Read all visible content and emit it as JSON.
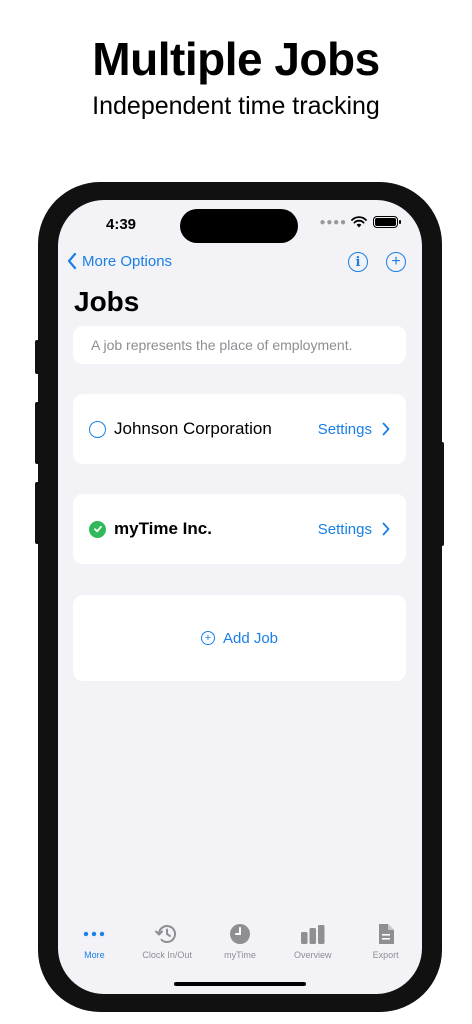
{
  "promo": {
    "headline": "Multiple Jobs",
    "subheadline": "Independent time tracking"
  },
  "status_bar": {
    "time": "4:39"
  },
  "nav": {
    "back_label": "More Options",
    "info_icon": "info-circle-icon",
    "add_icon": "plus-circle-icon"
  },
  "page": {
    "title": "Jobs",
    "description": "A job represents the place of employment."
  },
  "jobs": [
    {
      "name": "Johnson Corporation",
      "selected": false,
      "settings_label": "Settings"
    },
    {
      "name": "myTime Inc.",
      "selected": true,
      "settings_label": "Settings"
    }
  ],
  "add_job_label": "Add Job",
  "tabbar": {
    "tabs": [
      {
        "label": "More",
        "icon": "ellipsis-icon",
        "active": true
      },
      {
        "label": "Clock In/Out",
        "icon": "clock-history-icon",
        "active": false
      },
      {
        "label": "myTime",
        "icon": "clock-icon",
        "active": false
      },
      {
        "label": "Overview",
        "icon": "bar-chart-icon",
        "active": false
      },
      {
        "label": "Export",
        "icon": "document-icon",
        "active": false
      }
    ]
  },
  "colors": {
    "accent": "#1a7fe6",
    "success": "#30b85a",
    "background": "#f2f2f7",
    "inactive": "#8e8e93"
  }
}
